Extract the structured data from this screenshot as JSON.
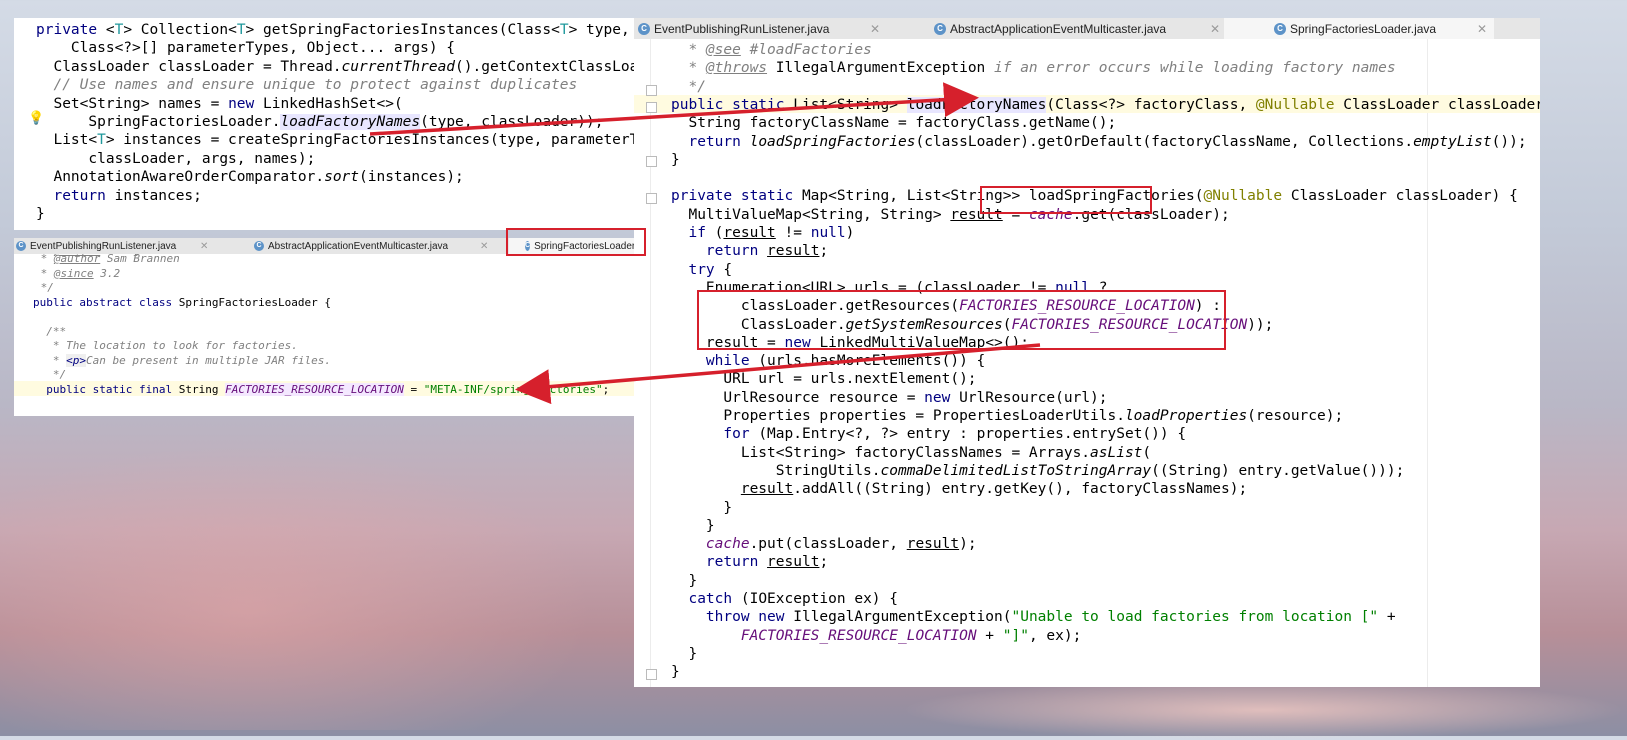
{
  "top_editor": {
    "lines": [
      "private <T> Collection<T> getSpringFactoriesInstances(Class<T> type,",
      "    Class<?>[] parameterTypes, Object... args) {",
      "  ClassLoader classLoader = Thread.currentThread().getContextClassLoader();",
      "  // Use names and ensure unique to protect against duplicates",
      "  Set<String> names = new LinkedHashSet<>(",
      "      SpringFactoriesLoader.loadFactoryNames(type, classLoader));",
      "  List<T> instances = createSpringFactoriesInstances(type, parameterTypes,",
      "      classLoader, args, names);",
      "  AnnotationAwareOrderComparator.sort(instances);",
      "  return instances;",
      "}"
    ]
  },
  "small_tabs": [
    {
      "label": "EventPublishingRunListener.java",
      "icon": "class-icon"
    },
    {
      "label": "AbstractApplicationEventMulticaster.java",
      "icon": "class-icon"
    },
    {
      "label": "SpringFactoriesLoader.j",
      "icon": "class-icon"
    }
  ],
  "small_editor": {
    "lines": [
      " * @author Juergen Hoeller",
      " * @author Sam Brannen",
      " * @since 3.2",
      " */",
      "public abstract class SpringFactoriesLoader {",
      "",
      "  /**",
      "   * The location to look for factories.",
      "   * <p>Can be present in multiple JAR files.",
      "   */",
      "  public static final String FACTORIES_RESOURCE_LOCATION = \"META-INF/spring.factories\";"
    ]
  },
  "main_tabs": [
    {
      "label": "EventPublishingRunListener.java",
      "icon": "class-icon"
    },
    {
      "label": "AbstractApplicationEventMulticaster.java",
      "icon": "class-icon"
    },
    {
      "label": "SpringFactoriesLoader.java",
      "icon": "class-icon",
      "active": true
    }
  ],
  "main_editor": {
    "lines": [
      " * @see #loadFactories",
      " * @throws IllegalArgumentException if an error occurs while loading factory names",
      " */",
      "public static List<String> loadFactoryNames(Class<?> factoryClass, @Nullable ClassLoader classLoader) {",
      "  String factoryClassName = factoryClass.getName();",
      "  return loadSpringFactories(classLoader).getOrDefault(factoryClassName, Collections.emptyList());",
      "}",
      "",
      "private static Map<String, List<String>> loadSpringFactories(@Nullable ClassLoader classLoader) {",
      "  MultiValueMap<String, String> result = cache.get(classLoader);",
      "  if (result != null)",
      "    return result;",
      "  try {",
      "    Enumeration<URL> urls = (classLoader != null ?",
      "        classLoader.getResources(FACTORIES_RESOURCE_LOCATION) :",
      "        ClassLoader.getSystemResources(FACTORIES_RESOURCE_LOCATION));",
      "    result = new LinkedMultiValueMap<>();",
      "    while (urls.hasMoreElements()) {",
      "      URL url = urls.nextElement();",
      "      UrlResource resource = new UrlResource(url);",
      "      Properties properties = PropertiesLoaderUtils.loadProperties(resource);",
      "      for (Map.Entry<?, ?> entry : properties.entrySet()) {",
      "        List<String> factoryClassNames = Arrays.asList(",
      "            StringUtils.commaDelimitedListToStringArray((String) entry.getValue()));",
      "        result.addAll((String) entry.getKey(), factoryClassNames);",
      "      }",
      "    }",
      "    cache.put(classLoader, result);",
      "    return result;",
      "  }",
      "  catch (IOException ex) {",
      "    throw new IllegalArgumentException(\"Unable to load factories from location [\" +",
      "        FACTORIES_RESOURCE_LOCATION + \"]\", ex);",
      "  }",
      "}"
    ]
  },
  "colors": {
    "annotation_red": "#d6202c",
    "keyword": "#000080",
    "string": "#008000",
    "constant": "#660e7a"
  }
}
